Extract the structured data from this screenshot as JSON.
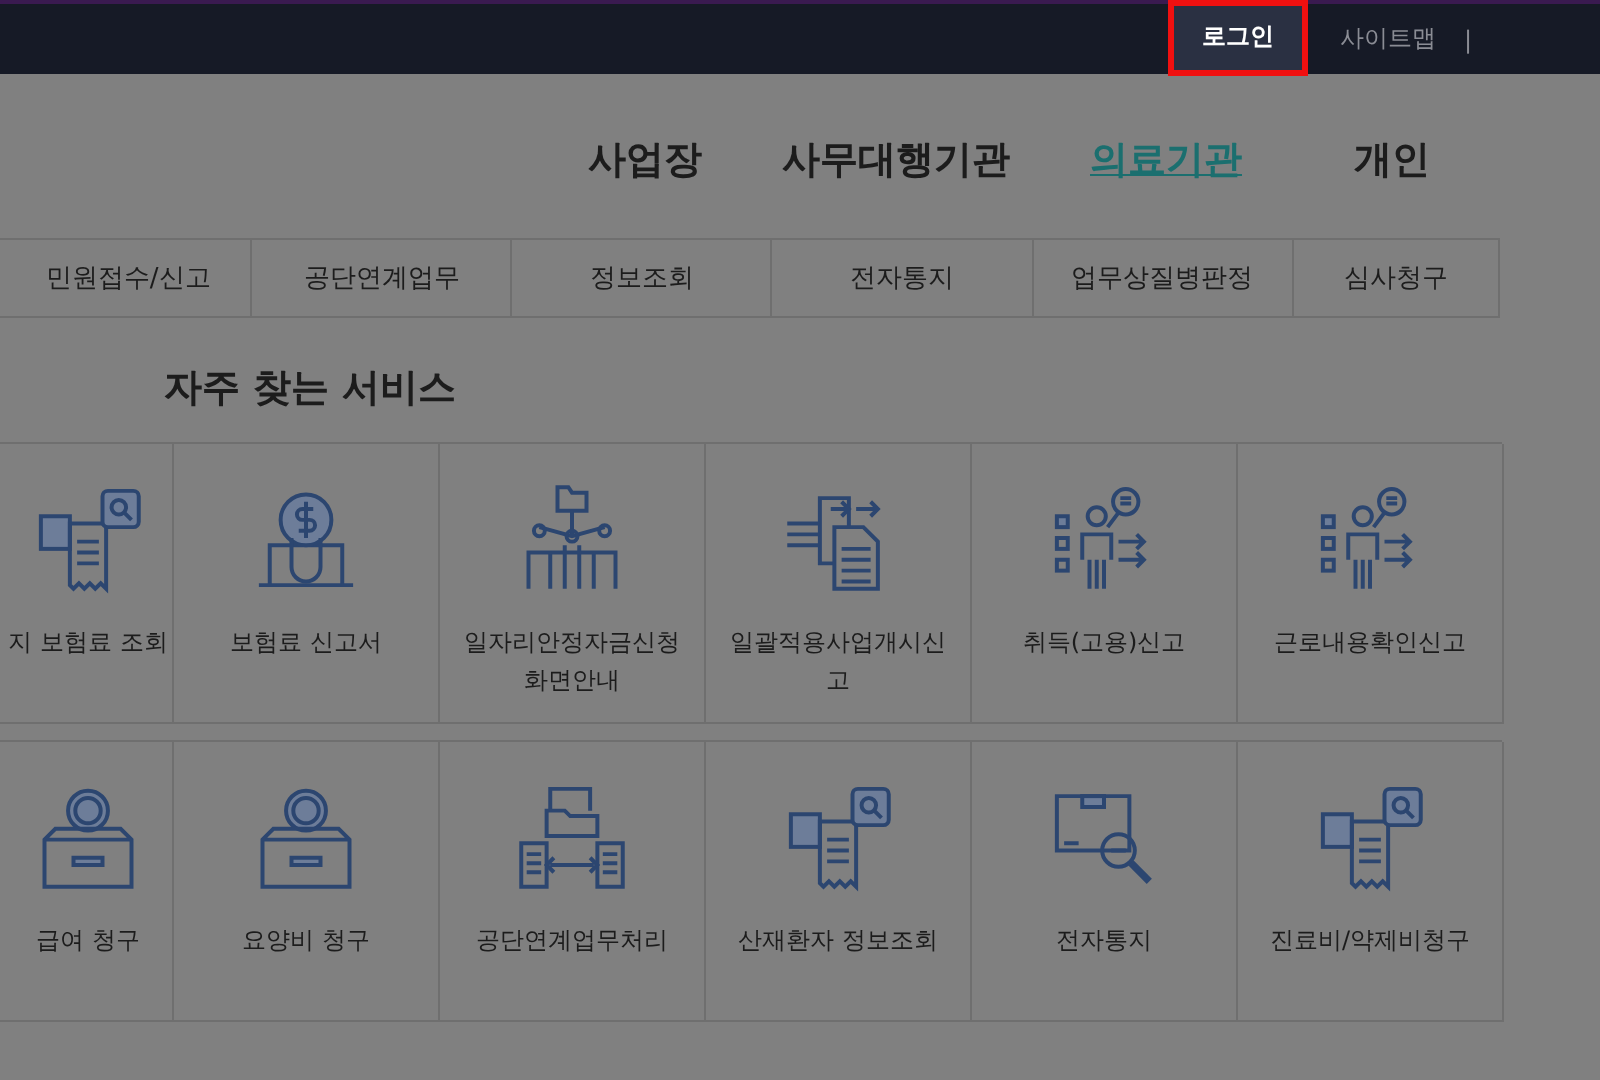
{
  "top_bar": {
    "login": {
      "label": "로그인",
      "highlighted": true
    },
    "links": [
      "사이트맵",
      "|"
    ]
  },
  "user_tabs": [
    {
      "label": "사업장",
      "selected": false
    },
    {
      "label": "사무대행기관",
      "selected": false
    },
    {
      "label": "의료기관",
      "selected": true
    },
    {
      "label": "개인",
      "selected": false
    }
  ],
  "menu": [
    "민원접수/신고",
    "공단연계업무",
    "정보조회",
    "전자통지",
    "업무상질병판정",
    "심사청구"
  ],
  "services": {
    "title": "자주 찾는 서비스",
    "rows": [
      [
        {
          "label": "지 보험료 조회",
          "kind": "docsearch"
        },
        {
          "label": "보험료 신고서",
          "kind": "coinlaptop"
        },
        {
          "label": "일자리안정자금신청화면안내",
          "kind": "network"
        },
        {
          "label": "일괄적용사업개시신고",
          "kind": "transfer"
        },
        {
          "label": "취득(고용)신고",
          "kind": "person"
        },
        {
          "label": "근로내용확인신고",
          "kind": "person"
        }
      ],
      [
        {
          "label": "급여 청구",
          "kind": "coinbox"
        },
        {
          "label": "요양비 청구",
          "kind": "coinbox"
        },
        {
          "label": "공단연계업무처리",
          "kind": "exchange"
        },
        {
          "label": "산재환자 정보조회",
          "kind": "docsearch"
        },
        {
          "label": "전자통지",
          "kind": "parcel"
        },
        {
          "label": "진료비/약제비청구",
          "kind": "docsearch"
        }
      ]
    ]
  }
}
